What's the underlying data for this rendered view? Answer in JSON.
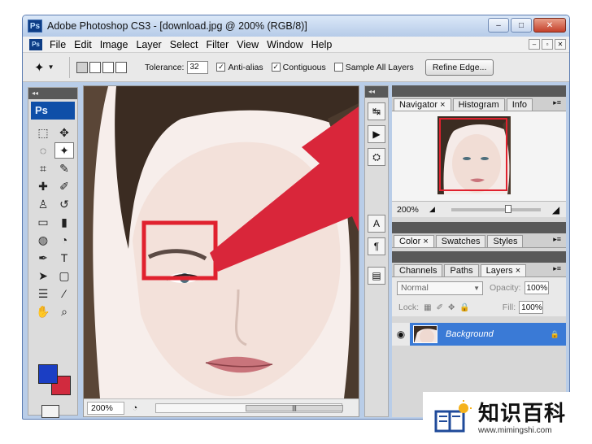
{
  "window": {
    "title": "Adobe Photoshop CS3 - [download.jpg @ 200% (RGB/8)]",
    "app_badge": "Ps",
    "controls": {
      "minimize": "–",
      "maximize": "□",
      "close": "✕"
    }
  },
  "menubar": {
    "items": [
      "File",
      "Edit",
      "Image",
      "Layer",
      "Select",
      "Filter",
      "View",
      "Window",
      "Help"
    ],
    "doc_controls": [
      "–",
      "▫",
      "✕"
    ]
  },
  "options": {
    "tolerance_label": "Tolerance:",
    "tolerance_value": "32",
    "antialias_label": "Anti-alias",
    "antialias_checked": "✓",
    "contiguous_label": "Contiguous",
    "contiguous_checked": "✓",
    "sample_all_label": "Sample All Layers",
    "refine_edge_label": "Refine Edge..."
  },
  "toolbox": {
    "collapse": "◂◂",
    "badge": "Ps",
    "tools": [
      {
        "name": "marquee-tool",
        "glyph": "⬚"
      },
      {
        "name": "move-tool",
        "glyph": "✥"
      },
      {
        "name": "lasso-tool",
        "glyph": "◌"
      },
      {
        "name": "magic-wand-tool",
        "glyph": "✦"
      },
      {
        "name": "crop-tool",
        "glyph": "⌗"
      },
      {
        "name": "slice-tool",
        "glyph": "✎"
      },
      {
        "name": "healing-tool",
        "glyph": "✚"
      },
      {
        "name": "brush-tool",
        "glyph": "✐"
      },
      {
        "name": "stamp-tool",
        "glyph": "♙"
      },
      {
        "name": "history-brush-tool",
        "glyph": "↺"
      },
      {
        "name": "eraser-tool",
        "glyph": "▭"
      },
      {
        "name": "gradient-tool",
        "glyph": "▮"
      },
      {
        "name": "blur-tool",
        "glyph": "◍"
      },
      {
        "name": "dodge-tool",
        "glyph": "◔"
      },
      {
        "name": "pen-tool",
        "glyph": "✒"
      },
      {
        "name": "type-tool",
        "glyph": "T"
      },
      {
        "name": "path-select-tool",
        "glyph": "➤"
      },
      {
        "name": "shape-tool",
        "glyph": "▢"
      },
      {
        "name": "notes-tool",
        "glyph": "☰"
      },
      {
        "name": "eyedropper-tool",
        "glyph": "⁄"
      },
      {
        "name": "hand-tool",
        "glyph": "✋"
      },
      {
        "name": "zoom-tool",
        "glyph": "⌕"
      }
    ],
    "foreground_color": "#1b3ec4",
    "background_color": "#d12a3e"
  },
  "canvas": {
    "zoom": "200%",
    "highlight_color": "#e0212e",
    "arrow_color": "#d9263a",
    "scroll_grip": "|||"
  },
  "dock": {
    "collapse": "◂◂",
    "buttons": [
      "↹",
      "▶",
      "⛭",
      "A",
      "¶",
      "▤"
    ]
  },
  "navigator_panel": {
    "tabs": [
      "Navigator ×",
      "Histogram",
      "Info"
    ],
    "zoom": "200%",
    "menu": "▸≡"
  },
  "color_panel": {
    "tabs": [
      "Color ×",
      "Swatches",
      "Styles"
    ]
  },
  "layers_panel": {
    "tabs": [
      "Channels",
      "Paths",
      "Layers ×"
    ],
    "blend_mode": "Normal",
    "opacity_label": "Opacity:",
    "opacity_value": "100%",
    "lock_label": "Lock:",
    "fill_label": "Fill:",
    "fill_value": "100%",
    "layer_name": "Background"
  },
  "watermark": {
    "title": "知识百科",
    "url": "www.mimingshi.com"
  }
}
